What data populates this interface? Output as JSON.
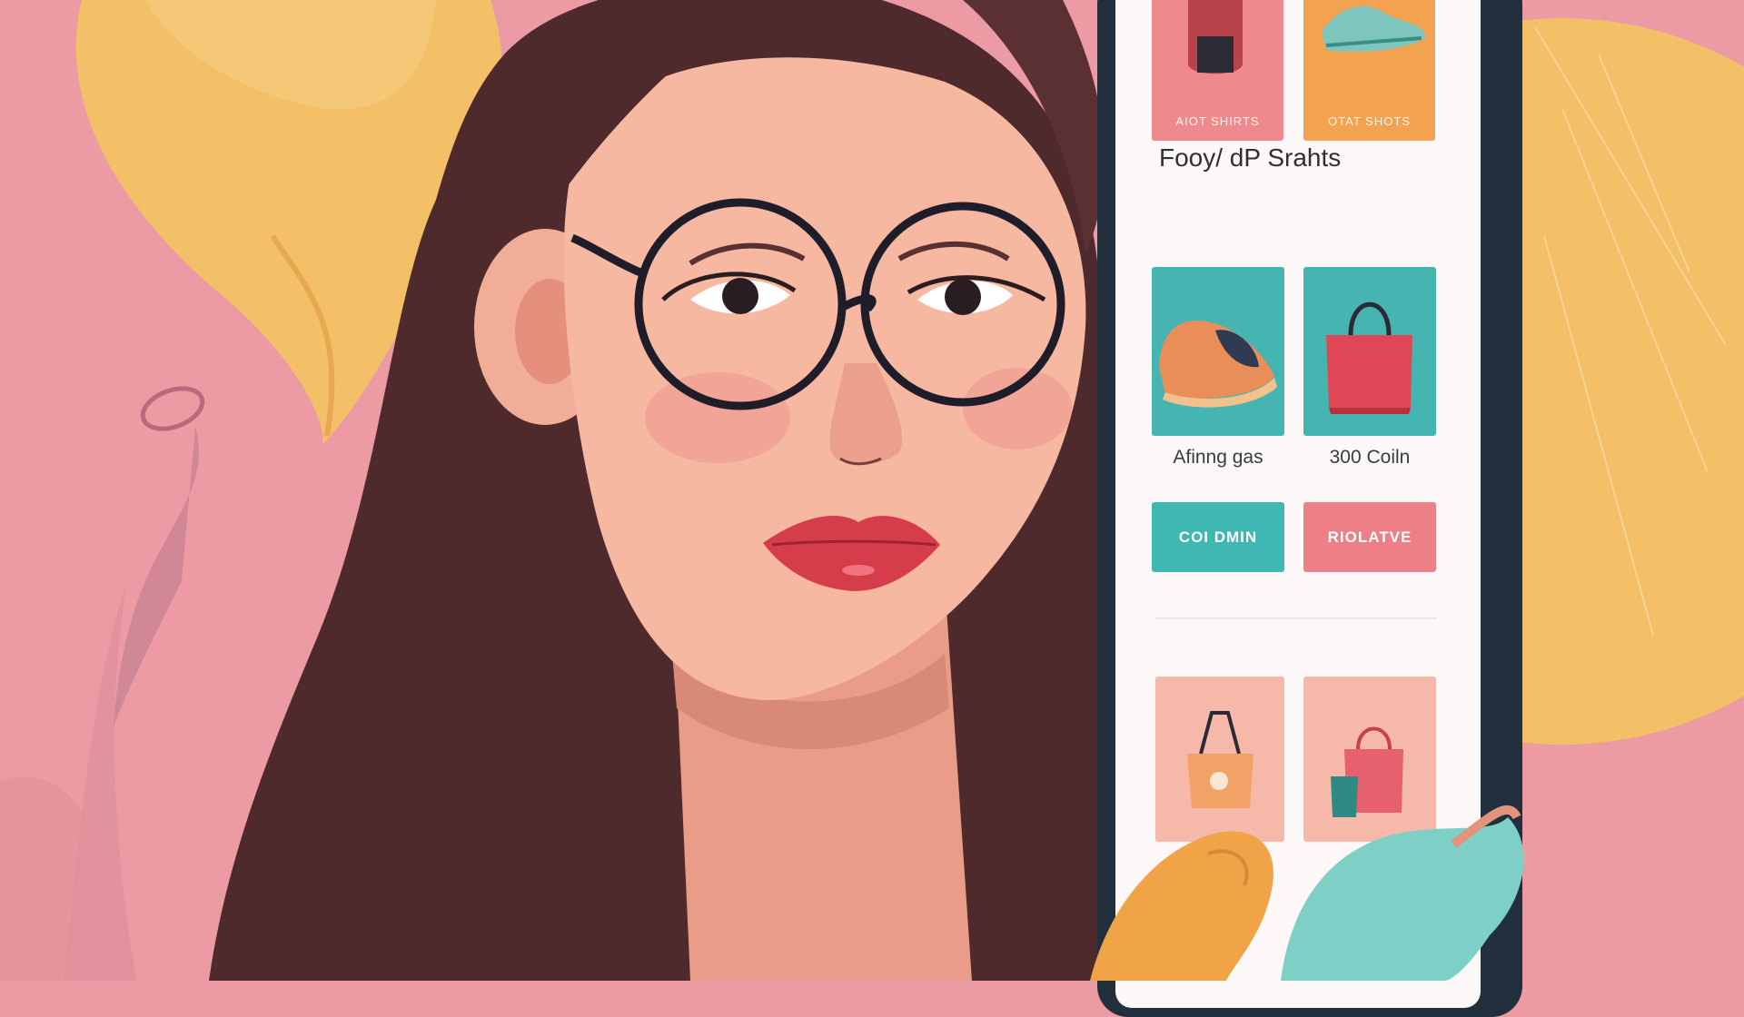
{
  "colors": {
    "background_pink": "#ec9aa3",
    "accent_yellow": "#f3c068",
    "hair_brown": "#4e2a2d",
    "skin": "#f3b39c",
    "teal": "#3fb7b2",
    "coral": "#ee7f86",
    "orange": "#f3a24f",
    "phone_frame": "#22303e",
    "screen": "#fbf8f7"
  },
  "app": {
    "top_tiles": [
      {
        "caption": "AIOT SHIRTS",
        "icon": "boot-icon",
        "bg": "#ee8a8d"
      },
      {
        "caption": "OTAT SHOTS",
        "icon": "shoe-icon",
        "bg": "#f3a24f"
      }
    ],
    "section_title": "Fooy/ dP Srahts",
    "products": [
      {
        "image": "loafer-shoe-icon",
        "price": "Afinng gas",
        "button": "COI DMIN",
        "button_color": "#3fb7b2"
      },
      {
        "image": "handbag-icon",
        "price": "300 Coiln",
        "button": "RIOLATVE",
        "button_color": "#ee7f86"
      }
    ],
    "bottom_tiles": [
      {
        "icon": "tote-bag-icon",
        "bg": "#f6b8a8"
      },
      {
        "icon": "bag-pair-icon",
        "bg": "#f6b8a8"
      }
    ]
  }
}
